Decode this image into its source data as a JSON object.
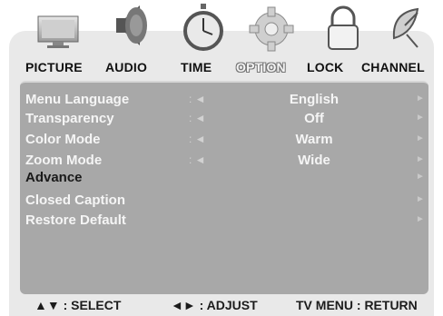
{
  "tabs": [
    {
      "label": "PICTURE",
      "icon": "tv-monitor-icon"
    },
    {
      "label": "AUDIO",
      "icon": "speaker-icon"
    },
    {
      "label": "TIME",
      "icon": "stopwatch-icon"
    },
    {
      "label": "OPTION",
      "icon": "gear-icon",
      "active": true
    },
    {
      "label": "LOCK",
      "icon": "padlock-icon"
    },
    {
      "label": "CHANNEL",
      "icon": "satellite-dish-icon"
    }
  ],
  "menu": {
    "rows": [
      {
        "label": "Menu Language",
        "symbol": ": ◄",
        "value": "English",
        "arrow": "►"
      },
      {
        "label": "Transparency",
        "symbol": ": ◄",
        "value": "Off",
        "arrow": "►"
      },
      {
        "label": "Color Mode",
        "symbol": ": ◄",
        "value": "Warm",
        "arrow": "►"
      },
      {
        "label": "Zoom Mode",
        "symbol": ": ◄",
        "value": "Wide",
        "arrow": "►"
      },
      {
        "label": "Advance",
        "symbol": "",
        "value": "",
        "arrow": "►",
        "selected": true
      },
      {
        "label": "Closed Caption",
        "symbol": "",
        "value": "",
        "arrow": "►"
      },
      {
        "label": "Restore Default",
        "symbol": "",
        "value": "",
        "arrow": "►"
      }
    ]
  },
  "footer": {
    "select_icon": "▲▼",
    "select_label": ": SELECT",
    "adjust_icon": "◄►",
    "adjust_label": ": ADJUST",
    "return_label": "TV MENU : RETURN"
  },
  "colors": {
    "panel": "#a8a8a8",
    "osd_bg": "#e9e9e9",
    "text_light": "#f5f5f5",
    "text_dark": "#1a1a1a"
  }
}
